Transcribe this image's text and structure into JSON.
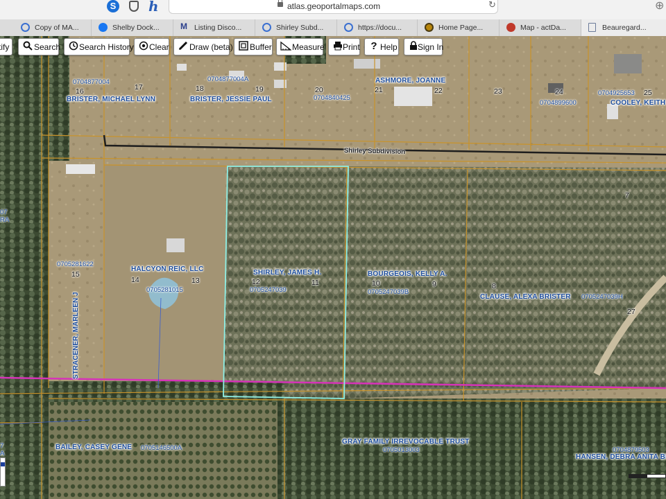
{
  "browser": {
    "url": "atlas.geoportalmaps.com",
    "extension_icons": [
      "skype-icon",
      "shield-icon",
      "honey-icon"
    ],
    "tabs": [
      {
        "label": "Copy of MA...",
        "icon": "chrome-doc-icon",
        "color": "#3a6fd1"
      },
      {
        "label": "Shelby Dock...",
        "icon": "facebook-icon",
        "color": "#1877f2"
      },
      {
        "label": "Listing Disco...",
        "icon": "m-logo-icon",
        "color": "#2b3f8c"
      },
      {
        "label": "Shirley Subd...",
        "icon": "pin-icon",
        "color": "#3a6fd1"
      },
      {
        "label": "https://docu...",
        "icon": "globe-icon",
        "color": "#3a6fd1"
      },
      {
        "label": "Home Page...",
        "icon": "badge-icon",
        "color": "#b8860b"
      },
      {
        "label": "Map - actDa...",
        "icon": "gear-icon",
        "color": "#c0392b"
      },
      {
        "label": "Beauregard...",
        "icon": "document-icon",
        "color": "#6b7a99"
      }
    ]
  },
  "toolbar": [
    {
      "label": "tify",
      "icon": "identify-icon"
    },
    {
      "label": "Search",
      "icon": "search-icon"
    },
    {
      "label": "Search History",
      "icon": "clock-icon"
    },
    {
      "label": "Clear",
      "icon": "target-icon"
    },
    {
      "label": "Draw (beta)",
      "icon": "pencil-icon"
    },
    {
      "label": "Buffer",
      "icon": "buffer-icon"
    },
    {
      "label": "Measure",
      "icon": "ruler-icon"
    },
    {
      "label": "Print",
      "icon": "printer-icon"
    },
    {
      "label": "Help",
      "icon": "help-icon"
    },
    {
      "label": "Sign In",
      "icon": "lock-icon"
    }
  ],
  "map": {
    "road_name": "Shirley Subdivision",
    "colors": {
      "parcel_line": "#c9932a",
      "selected_parcel": "#8ff0e6",
      "road": "#1e1e1e",
      "pink_line": "#d633b8",
      "label": "#1d4d9c"
    },
    "owners": [
      "BRISTER, MICHAEL LYNN",
      "BRISTER, JESSIE PAUL",
      "ASHMORE, JOANNE",
      "COOLEY, KEITH A",
      "HALCYON REIC, LLC",
      "SHIRLEY, JAMES H.",
      "BOURGEOIS, KELLY A.",
      "CLAUSE, ALEXA BRISTER",
      "STRACENER, MARLEEN J",
      "BAILEY, CASEY GENE",
      "GRAY FAMILY IRREVOCABLE TRUST",
      "HANSEN, DEBRA ANITA BRI"
    ],
    "parcel_ids": [
      "0704877004",
      "0704877004A",
      "0704840425",
      "0704899600",
      "0704925653",
      "0705281622",
      "0705281015",
      "0705247039",
      "0705247039B",
      "0705247039H",
      "0705146500A",
      "0705013003",
      "0704879503"
    ],
    "lot_numbers": [
      "16",
      "17",
      "18",
      "19",
      "20",
      "21",
      "22",
      "23",
      "24",
      "25",
      "7",
      "15",
      "14",
      "13",
      "12",
      "11",
      "10",
      "9",
      "8",
      "27"
    ],
    "edge_fragments": [
      "07",
      "RA",
      "7",
      "A"
    ]
  }
}
